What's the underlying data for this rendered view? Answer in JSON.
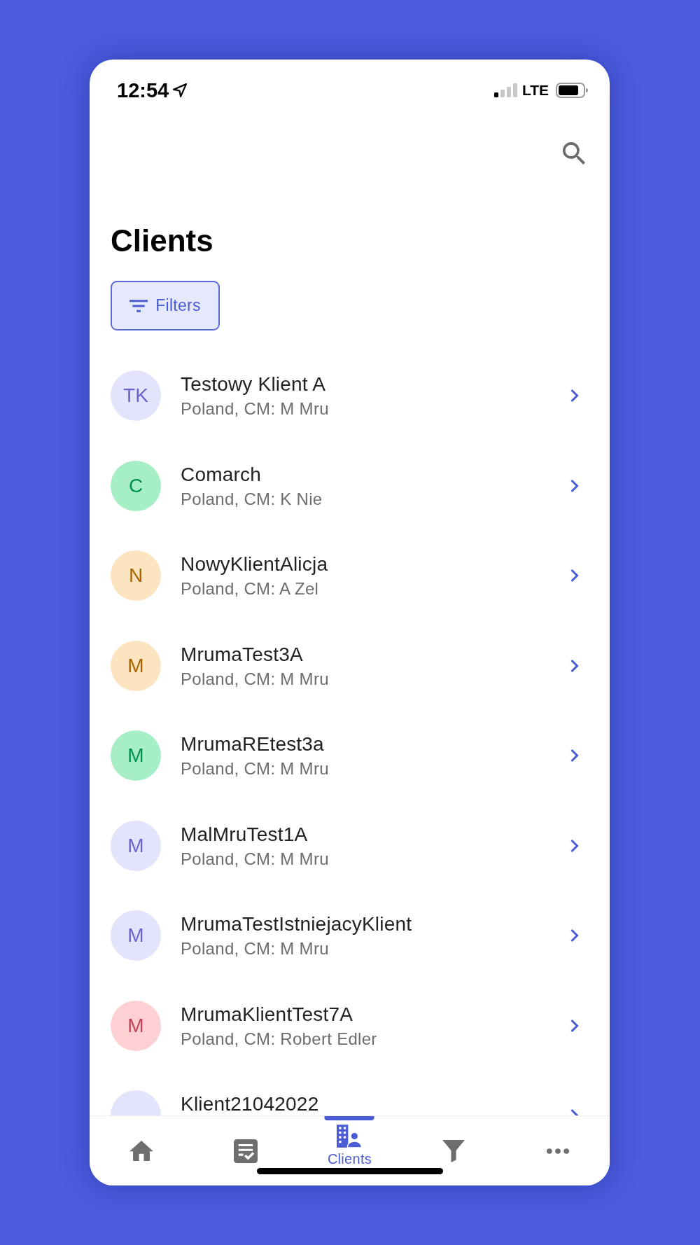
{
  "status_bar": {
    "time": "12:54",
    "network": "LTE"
  },
  "header": {
    "title": "Clients",
    "filter_button": "Filters"
  },
  "clients": [
    {
      "initials": "TK",
      "name": "Testowy Klient A",
      "details": "Poland, CM: M Mru",
      "color": "#e3e4fb"
    },
    {
      "initials": "C",
      "name": "Comarch",
      "details": "Poland, CM: K Nie",
      "color": "#a6efc6"
    },
    {
      "initials": "N",
      "name": "NowyKlientAlicja",
      "details": "Poland, CM: A Zel",
      "color": "#fde4c0"
    },
    {
      "initials": "M",
      "name": "MrumaTest3A",
      "details": "Poland, CM: M Mru",
      "color": "#fde4c0"
    },
    {
      "initials": "M",
      "name": "MrumaREtest3a",
      "details": "Poland, CM: M Mru",
      "color": "#a6efc6"
    },
    {
      "initials": "M",
      "name": "MalMruTest1A",
      "details": "Poland, CM: M Mru",
      "color": "#e3e4fb"
    },
    {
      "initials": "M",
      "name": "MrumaTestIstniejacyKlient",
      "details": "Poland, CM: M Mru",
      "color": "#e3e4fb"
    },
    {
      "initials": "M",
      "name": "MrumaKlientTest7A",
      "details": "Poland, CM: Robert Edler",
      "color": "#fdd0d3"
    },
    {
      "name": "Klient21042022",
      "color": "#e3e4fb"
    }
  ],
  "bottom_nav": [
    {
      "selected": false
    },
    {
      "selected": false
    },
    {
      "label": "Clients",
      "selected": true
    },
    {
      "selected": false
    },
    {
      "selected": false
    }
  ]
}
